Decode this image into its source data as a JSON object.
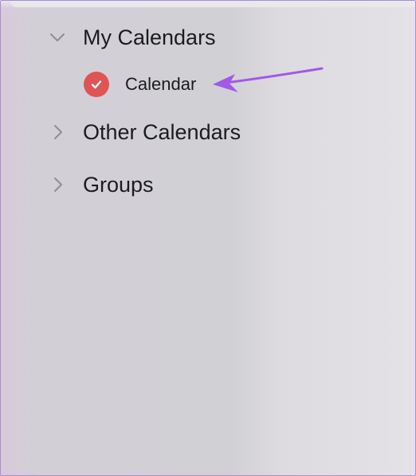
{
  "sidebar": {
    "sections": {
      "my_calendars": {
        "label": "My Calendars",
        "expanded": true,
        "icon": "chevron-down-icon"
      },
      "other_calendars": {
        "label": "Other Calendars",
        "expanded": false,
        "icon": "chevron-right-icon"
      },
      "groups": {
        "label": "Groups",
        "expanded": false,
        "icon": "chevron-right-icon"
      }
    },
    "calendars": [
      {
        "label": "Calendar",
        "checked": true,
        "color": "#df5454",
        "icon": "checkmark-icon"
      }
    ]
  },
  "annotation": {
    "icon": "pointer-arrow-icon",
    "color": "#a259e6"
  },
  "colors": {
    "text": "#1c1c1e",
    "chevron": "#8e8e93",
    "frame_border": "#a98ad6"
  }
}
